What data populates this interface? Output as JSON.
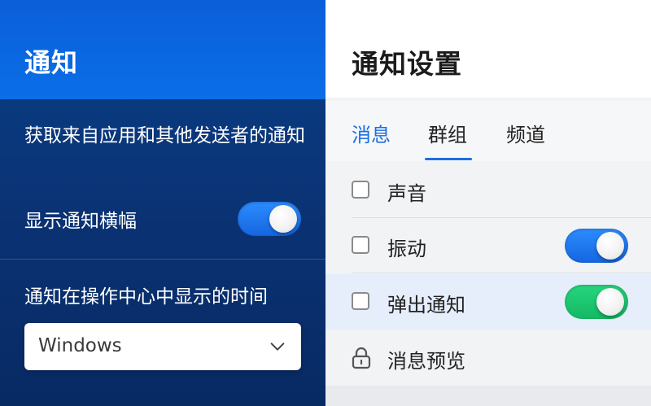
{
  "left": {
    "title": "通知",
    "description": "获取来自应用和其他发送者的通知",
    "banner_label": "显示通知横幅",
    "banner_toggle_on": true,
    "time_label": "通知在操作中心中显示的时间",
    "time_select_value": "Windows"
  },
  "right": {
    "title": "通知设置",
    "tabs": [
      {
        "label": "消息"
      },
      {
        "label": "群组"
      },
      {
        "label": "频道"
      }
    ],
    "selected_tab": "群组",
    "rows": [
      {
        "label": "声音",
        "icon": "checkbox-icon",
        "checked": false
      },
      {
        "label": "振动",
        "icon": "checkbox-icon",
        "checked": false,
        "toggle_on": true,
        "toggle_color": "#1466e0"
      },
      {
        "label": "弹出通知",
        "icon": "checkbox-icon",
        "checked": false,
        "toggle_on": true,
        "toggle_color": "#14b863"
      },
      {
        "label": "消息预览",
        "icon": "lock-icon"
      }
    ]
  },
  "colors": {
    "accent_blue": "#1a6fe0",
    "header_blue": "#0a6ee8",
    "panel_navy": "#0a3273",
    "toggle_green": "#14b863"
  }
}
